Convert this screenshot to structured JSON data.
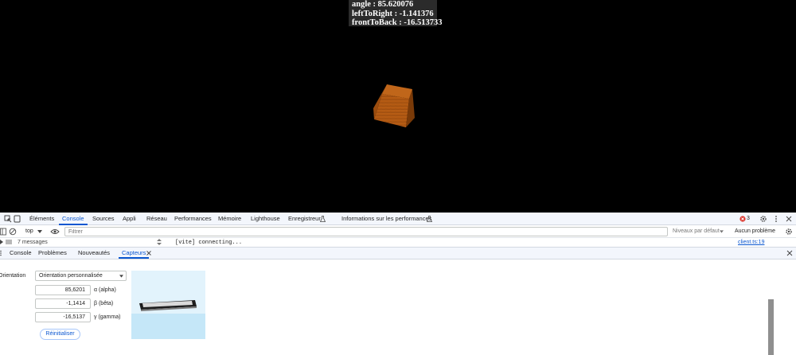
{
  "overlay": {
    "line1": "angle : 85.620076",
    "line2": "leftToRight : -1.141376",
    "line3": "frontToBack : -16.513733"
  },
  "colors": {
    "cube_face": "#b35a12",
    "accent": "#0b57d0",
    "error": "#dc362e",
    "sensor_preview_bg": "#cbeafa"
  },
  "devtools": {
    "tabs": [
      "Éléments",
      "Console",
      "Sources",
      "Appli",
      "Réseau",
      "Performances",
      "Mémoire",
      "Lighthouse",
      "Enregistreur",
      "Informations sur les performances"
    ],
    "active_tab": "Console",
    "error_count": "3",
    "toolbar": {
      "context": "top",
      "filter_placeholder": "Filtrer",
      "levels": "Niveaux par défaut",
      "issues": "Aucun problème"
    },
    "messages_count": "7 messages",
    "console_message": "[vite] connecting...",
    "console_source": "client.ts:19",
    "drawer_tabs": [
      "Console",
      "Problèmes",
      "Nouveautés",
      "Capteurs"
    ],
    "active_drawer_tab": "Capteurs",
    "sensors": {
      "orientation_label": "Orientation",
      "orientation_select": "Orientation personnalisée",
      "alpha_value": "85,6201",
      "alpha_label": "α (alpha)",
      "beta_value": "-1,1414",
      "beta_label": "β (bêta)",
      "gamma_value": "-16,5137",
      "gamma_label": "γ (gamma)",
      "reset_button": "Réinitialiser"
    }
  }
}
